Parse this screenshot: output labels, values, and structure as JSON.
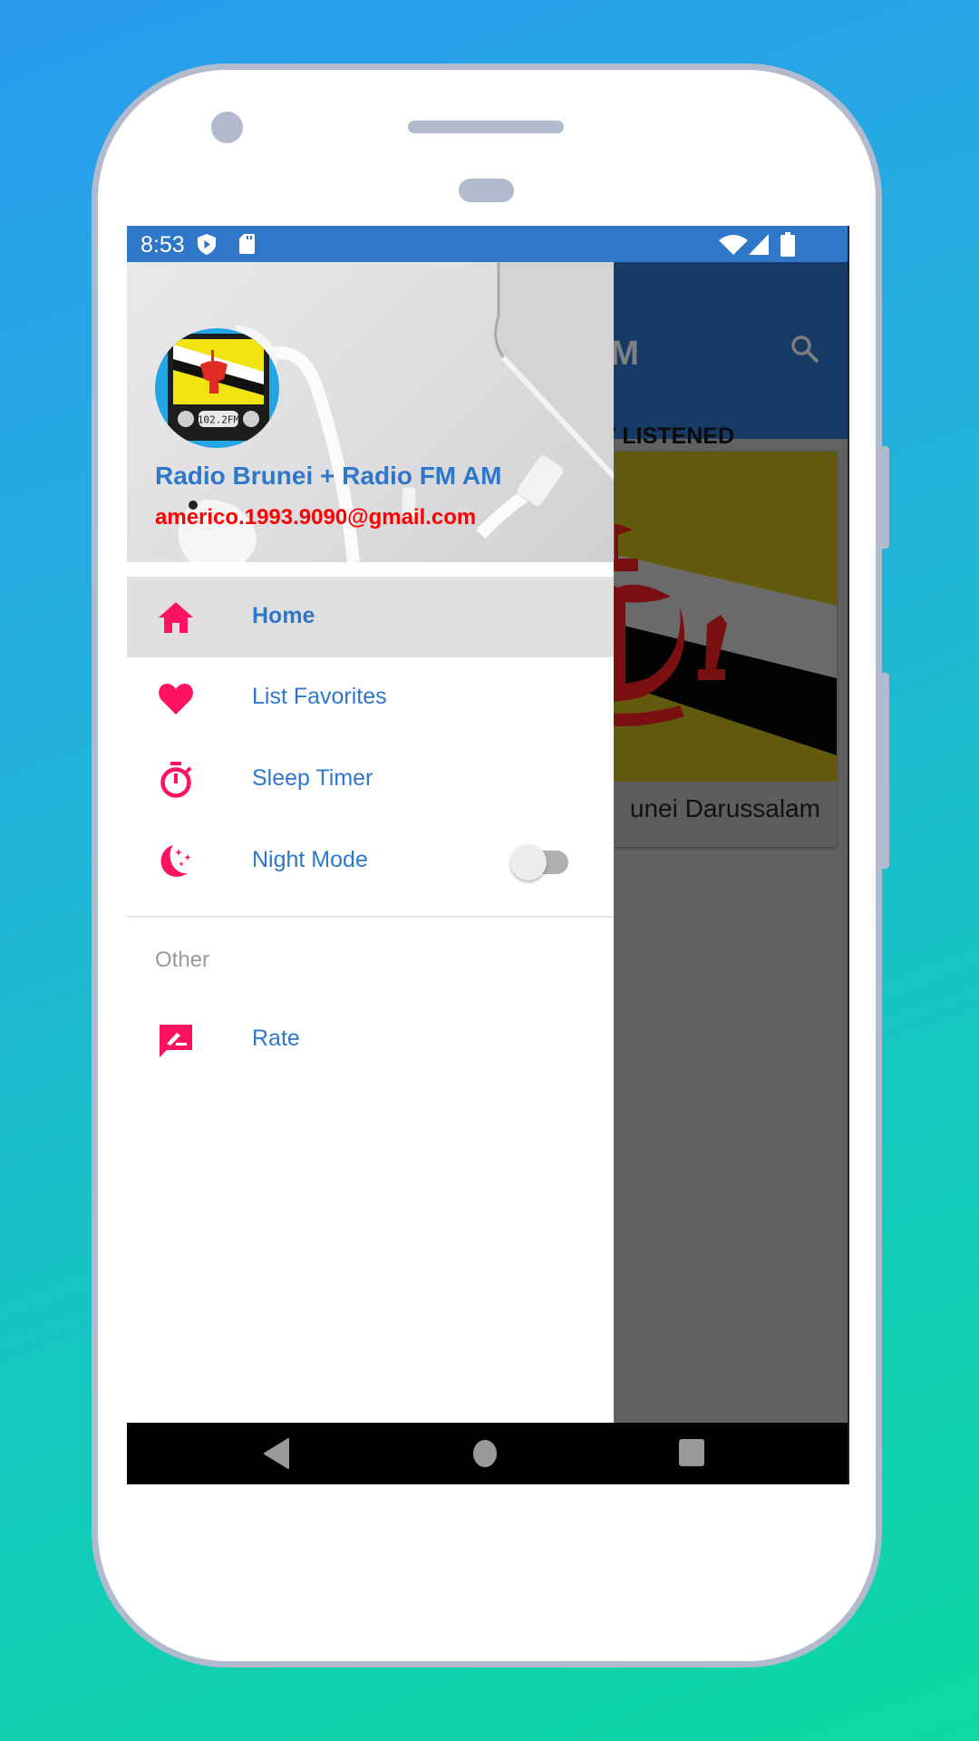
{
  "status_bar": {
    "time": "8:53",
    "left_icons": [
      "play-protect-shield-icon",
      "sd-card-icon"
    ],
    "right_icons": [
      "wifi-icon",
      "cell-signal-icon",
      "battery-icon"
    ],
    "color": "#2f78c9"
  },
  "background_app": {
    "title_partial": "M AM",
    "search_icon": "search-icon",
    "tab_partial": "IOST LISTENED",
    "card": {
      "label_partial": "unei Darussalam",
      "image": "brunei-flag"
    }
  },
  "drawer": {
    "header": {
      "app_name": "Radio Brunei + Radio FM AM",
      "email": "americo.1993.9090@gmail.com",
      "avatar": "radio-brunei-logo",
      "avatar_frequency": "102.2FM"
    },
    "items": [
      {
        "label": "Home",
        "icon": "home-icon",
        "active": true
      },
      {
        "label": "List Favorites",
        "icon": "heart-icon",
        "active": false
      },
      {
        "label": "Sleep Timer",
        "icon": "timer-icon",
        "active": false
      },
      {
        "label": "Night Mode",
        "icon": "moon-stars-icon",
        "active": false,
        "toggle": false
      }
    ],
    "section_other": {
      "title": "Other",
      "items": [
        {
          "label": "Rate",
          "icon": "rate-review-icon"
        }
      ]
    }
  },
  "colors": {
    "accent_icon": "#ff1361",
    "menu_text": "#2f78c9",
    "email": "#ff0000",
    "active_row": "#e0e0e0",
    "scrim": "#616161"
  },
  "navigation_bar": {
    "buttons": [
      "back",
      "home",
      "recents"
    ]
  }
}
